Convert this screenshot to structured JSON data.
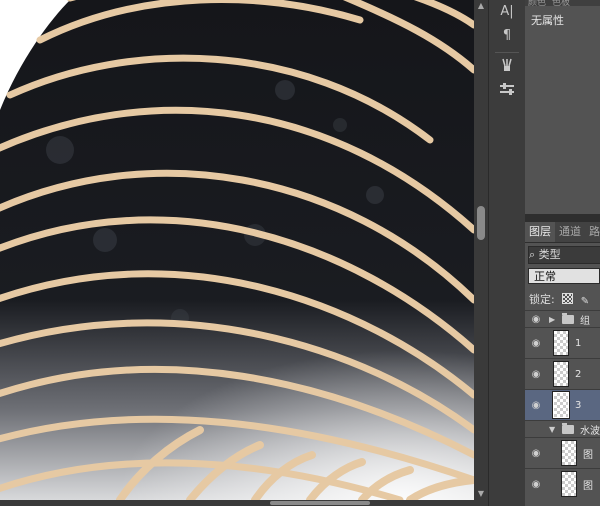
{
  "properties_panel": {
    "tabs": [
      "颜色",
      "色板"
    ],
    "body_text": "无属性"
  },
  "layers_panel": {
    "tabs": [
      "图层",
      "通道",
      "路"
    ],
    "filter_label": "⌕ 类型",
    "blend_mode": "正常",
    "lock_label": "锁定:",
    "layers": [
      {
        "type": "group",
        "name": "组",
        "expanded": false
      },
      {
        "type": "layer",
        "name": "1"
      },
      {
        "type": "layer",
        "name": "2"
      },
      {
        "type": "layer",
        "name": "3",
        "selected": true
      },
      {
        "type": "group",
        "name": "水波",
        "expanded": true
      },
      {
        "type": "layer",
        "name": "图"
      },
      {
        "type": "layer",
        "name": "图"
      }
    ]
  },
  "icons": {
    "text_tool": "A|",
    "paragraph_tool": "¶",
    "brush_presets": "brush-icon",
    "tool_presets": "sliders-icon",
    "eye": "eye-icon"
  }
}
